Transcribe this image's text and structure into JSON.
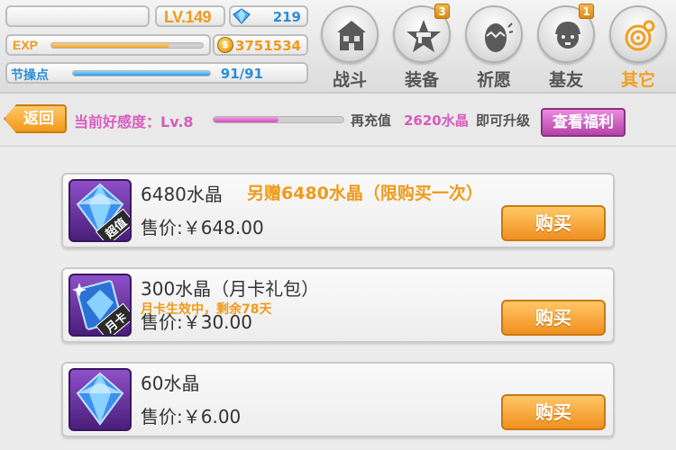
{
  "hud": {
    "level": "LV.149",
    "gems": "219",
    "exp_label": "EXP",
    "exp_progress": 0.78,
    "gold": "3751534",
    "gold_symbol": "$",
    "stamina_label": "节操点",
    "stamina_value": "91/91",
    "stamina_progress": 1.0
  },
  "menu": [
    {
      "label": "战斗",
      "icon": "house-icon",
      "badge": ""
    },
    {
      "label": "装备",
      "icon": "gun-star-icon",
      "badge": "3"
    },
    {
      "label": "祈愿",
      "icon": "egg-icon",
      "badge": ""
    },
    {
      "label": "基友",
      "icon": "friend-face-icon",
      "badge": "1"
    },
    {
      "label": "其它",
      "icon": "gear-target-icon",
      "badge": "",
      "active": true
    }
  ],
  "favor": {
    "back_label": "返回",
    "level_text": "当前好感度：Lv.8",
    "progress": 0.5,
    "recharge_prefix": "再充值",
    "recharge_amount": "2620水晶",
    "recharge_suffix": "即可升级",
    "welfare_label": "查看福利"
  },
  "items": [
    {
      "name": "6480水晶",
      "bonus": "另赠6480水晶（限购买一次）",
      "sub": "",
      "price": "售价:￥648.00",
      "tag": "超值",
      "buy": "购买"
    },
    {
      "name": "300水晶（月卡礼包）",
      "bonus": "",
      "sub": "月卡生效中，剩余78天",
      "price": "售价:￥30.00",
      "tag": "月卡",
      "buy": "购买"
    },
    {
      "name": "60水晶",
      "bonus": "",
      "sub": "",
      "price": "售价:￥6.00",
      "tag": "",
      "buy": "购买"
    }
  ],
  "colors": {
    "accent_orange": "#f09a1a",
    "accent_pink": "#d85bbf",
    "accent_blue": "#2d8ed6"
  }
}
